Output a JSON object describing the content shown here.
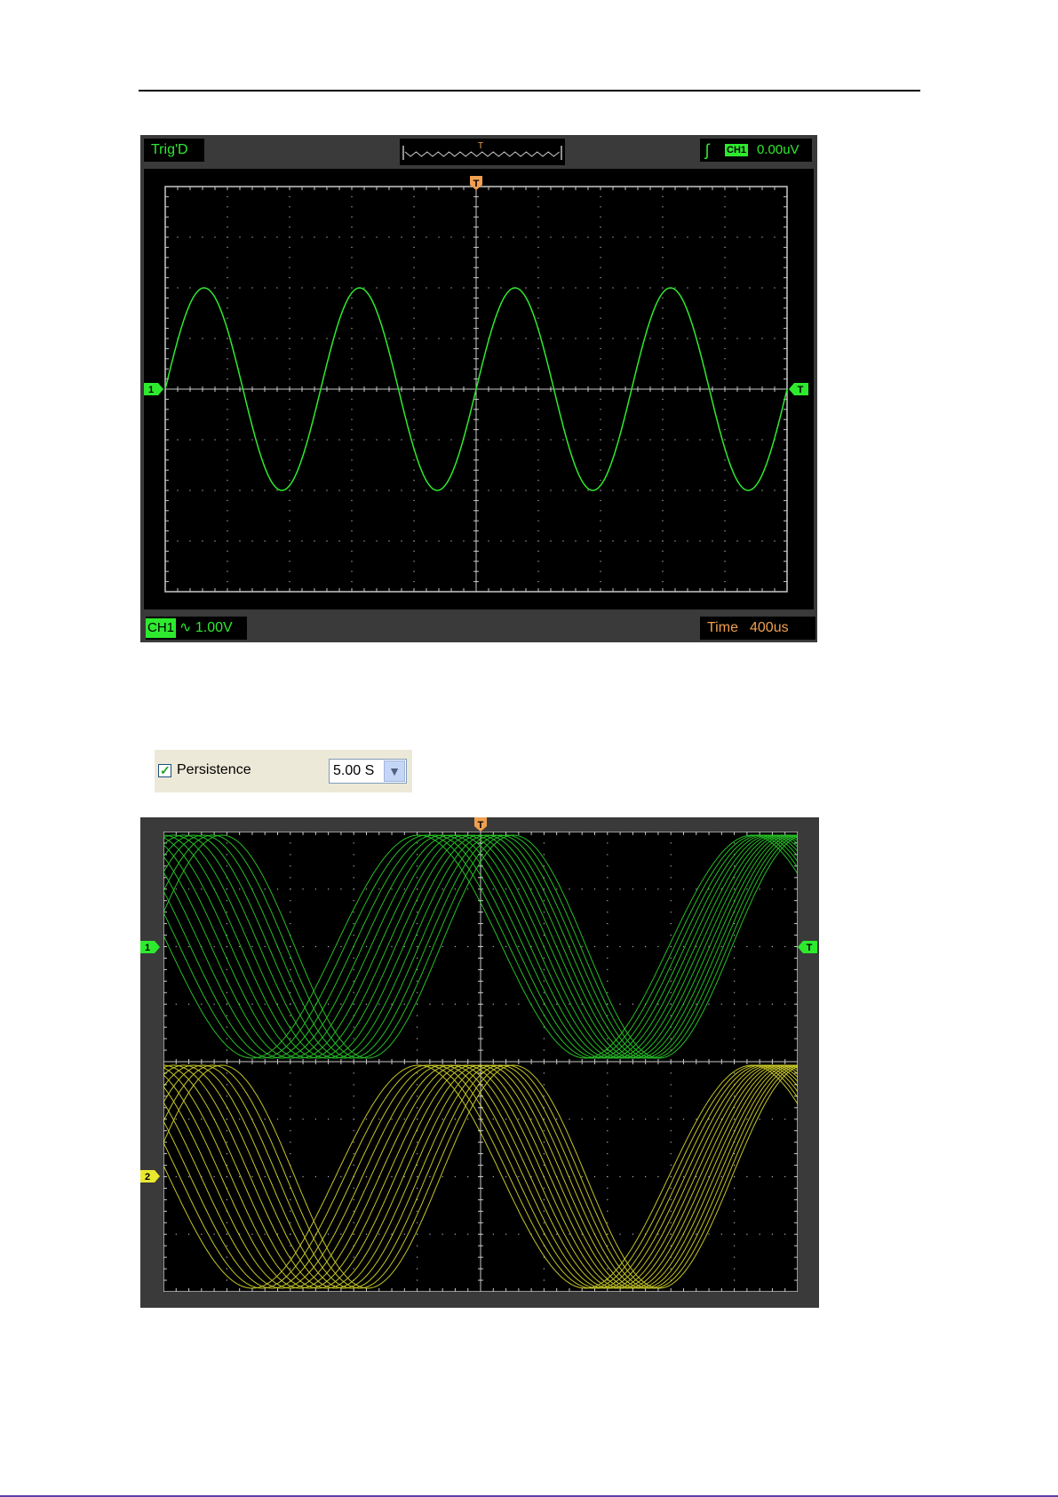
{
  "scope1": {
    "trigger_status": "Trig'D",
    "timeline_marker": "T",
    "trigger_channel": "CH1",
    "trigger_level": "0.00uV",
    "trigger_position_marker": "T",
    "ch1_marker": "1",
    "trigger_level_marker": "T",
    "channel_label": "CH1",
    "coupling_symbol": "∿",
    "volts_per_div": "1.00V",
    "time_label": "Time",
    "time_per_div": "400us",
    "trace_color": "#2eea2e"
  },
  "persistence": {
    "checked": true,
    "label": "Persistence",
    "value": "5.00 S",
    "dropdown_icon": "chevron-down-icon"
  },
  "scope2": {
    "trigger_position_marker": "T",
    "ch1_marker": "1",
    "ch2_marker": "2",
    "trigger_level_marker": "T",
    "ch1_color": "#2ee02e",
    "ch2_color": "#e8e830"
  },
  "colors": {
    "grid_dot": "#b0b0b0",
    "frame": "#3a3a3a",
    "trigger_orange": "#f0a050"
  }
}
